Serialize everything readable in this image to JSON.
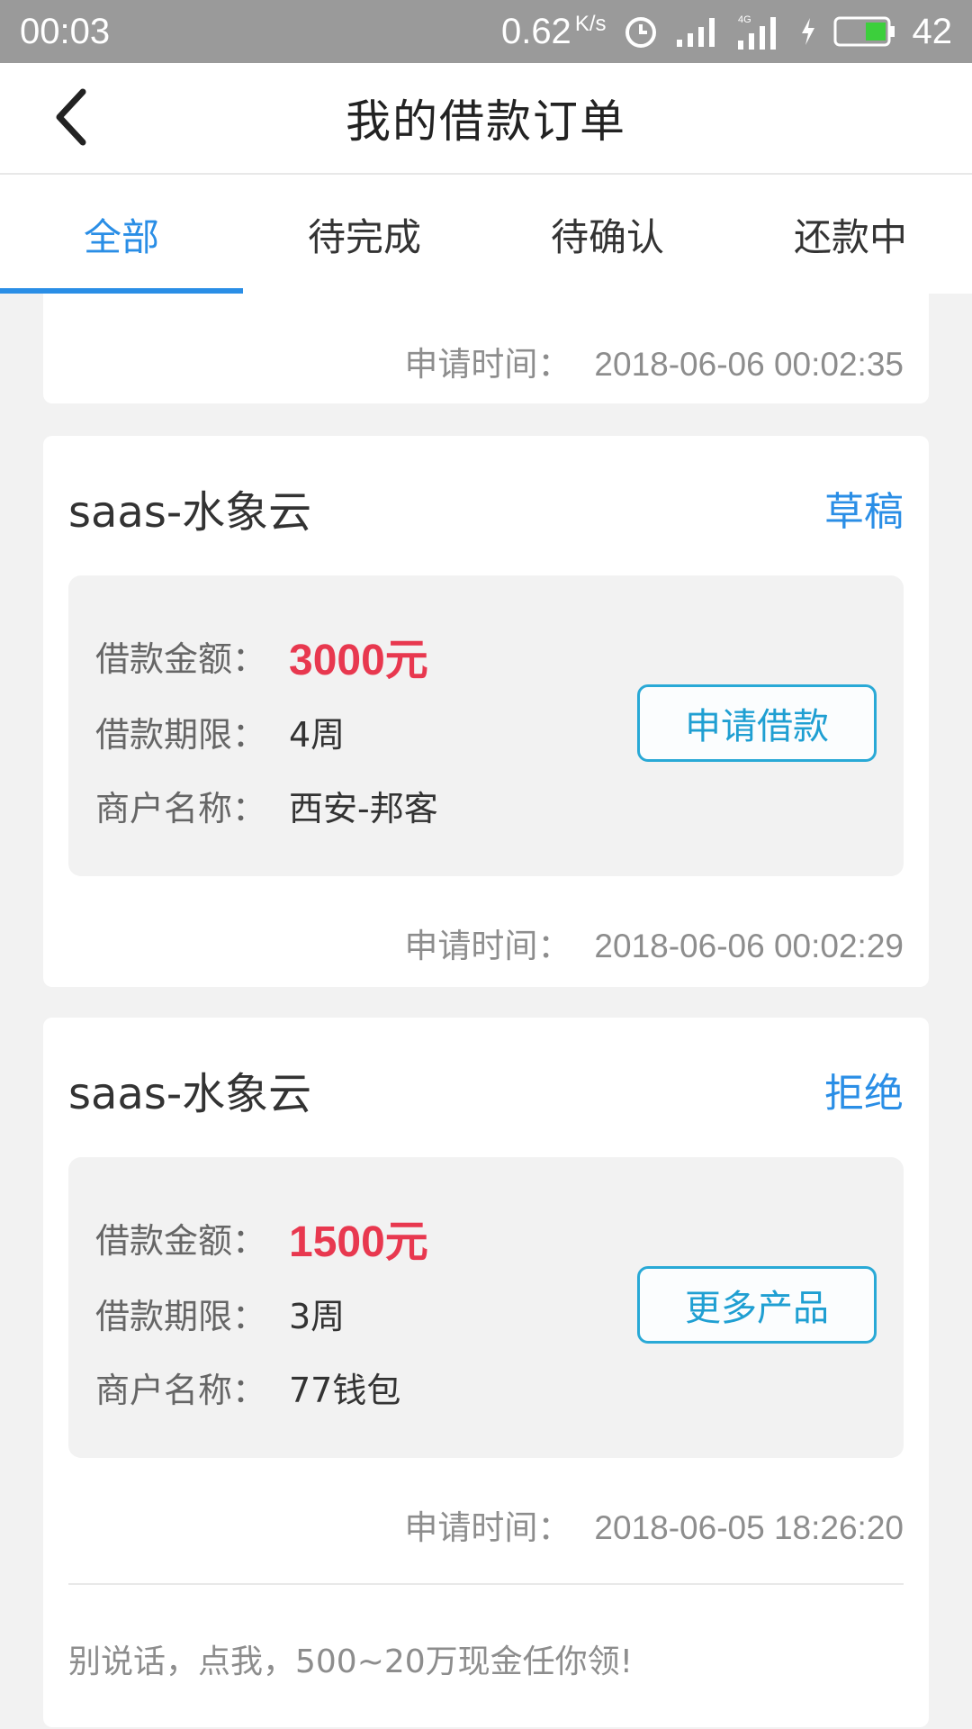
{
  "status_bar": {
    "time": "00:03",
    "net_speed": "0.62",
    "net_unit": "K/s",
    "battery_percent": "42",
    "icons": [
      "alarm-icon",
      "signal-icon",
      "signal-4g-icon",
      "charging-icon",
      "battery-icon"
    ]
  },
  "header": {
    "title": "我的借款订单",
    "back_icon": "chevron-left-icon"
  },
  "tabs": [
    {
      "label": "全部",
      "active": true
    },
    {
      "label": "待完成",
      "active": false
    },
    {
      "label": "待确认",
      "active": false
    },
    {
      "label": "还款中",
      "active": false
    }
  ],
  "labels": {
    "apply_time": "申请时间：",
    "amount": "借款金额：",
    "term": "借款期限：",
    "merchant": "商户名称："
  },
  "partial_card": {
    "apply_time": "2018-06-06 00:02:35"
  },
  "orders": [
    {
      "product": "saas-水象云",
      "status": "草稿",
      "amount": "3000元",
      "term": "4周",
      "merchant": "西安-邦客",
      "action": "申请借款",
      "apply_time": "2018-06-06 00:02:29"
    },
    {
      "product": "saas-水象云",
      "status": "拒绝",
      "amount": "1500元",
      "term": "3周",
      "merchant": "77钱包",
      "action": "更多产品",
      "apply_time": "2018-06-05 18:26:20"
    }
  ],
  "promo_text": "别说话，点我，500~20万现金任你领!",
  "colors": {
    "accent": "#2a8ee6",
    "amount_red": "#e8384f",
    "button_border": "#29a9d6"
  }
}
